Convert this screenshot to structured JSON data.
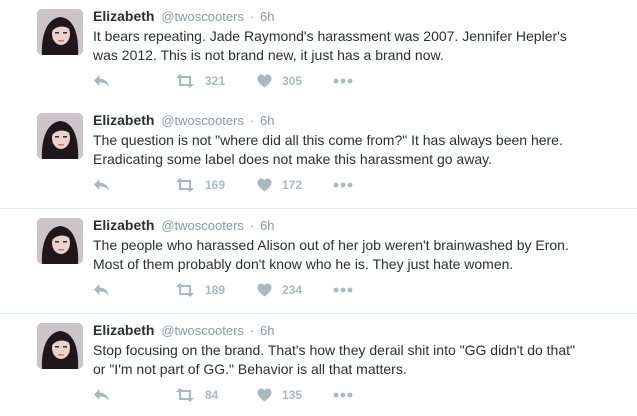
{
  "tweets": [
    {
      "name": "Elizabeth",
      "handle": "@twoscooters",
      "separator": "·",
      "time": "6h",
      "text": "It bears repeating. Jade Raymond's harassment was 2007. Jennifer Hepler's\nwas 2012. This is not brand new, it just has a brand now.",
      "retweets": "321",
      "likes": "305"
    },
    {
      "name": "Elizabeth",
      "handle": "@twoscooters",
      "separator": "·",
      "time": "6h",
      "text": "The question is not \"where did all this come from?\" It has always been here.\nEradicating some label does not make this harassment go away.",
      "retweets": "169",
      "likes": "172"
    },
    {
      "name": "Elizabeth",
      "handle": "@twoscooters",
      "separator": "·",
      "time": "6h",
      "text": "The people who harassed Alison out of her job weren't brainwashed by Eron.\nMost of them probably don't know who he is. They just hate women.",
      "retweets": "189",
      "likes": "234"
    },
    {
      "name": "Elizabeth",
      "handle": "@twoscooters",
      "separator": "·",
      "time": "6h",
      "text": "Stop focusing on the brand. That's how they derail shit into \"GG didn't do that\"\nor \"I'm not part of GG.\" Behavior is all that matters.",
      "retweets": "84",
      "likes": "135"
    }
  ],
  "icons": {
    "reply": "reply-icon",
    "retweet": "retweet-icon",
    "like": "heart-icon",
    "more": "more-icon"
  },
  "colors": {
    "action_gray": "#aab8c2",
    "meta_gray": "#8899a6",
    "text": "#292f33"
  }
}
